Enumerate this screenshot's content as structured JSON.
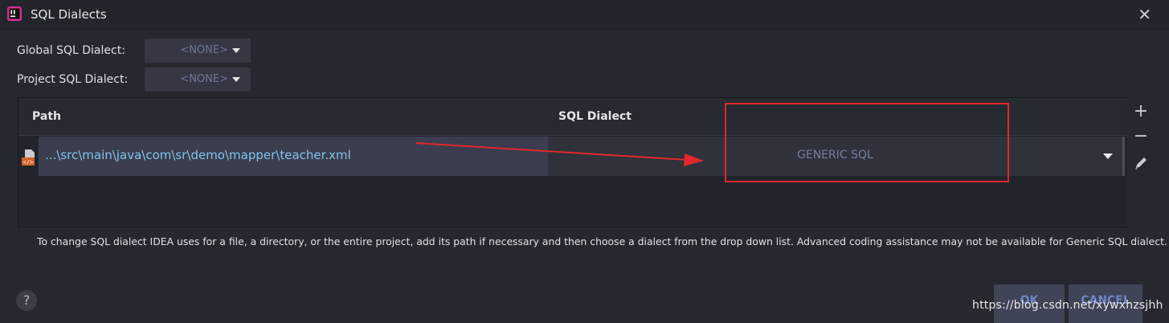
{
  "window": {
    "title": "SQL Dialects",
    "logo_icon": "intellij-idea-logo-icon",
    "close_icon": "close-icon",
    "close_glyph": "✕"
  },
  "global_dialect": {
    "label": "Global SQL Dialect:",
    "value": "<NONE>"
  },
  "project_dialect": {
    "label": "Project SQL Dialect:",
    "value": "<NONE>"
  },
  "table": {
    "columns": [
      "Path",
      "SQL Dialect"
    ],
    "rows": [
      {
        "path": "...\\src\\main\\java\\com\\sr\\demo\\mapper\\teacher.xml",
        "dialect": "GENERIC SQL",
        "icon": "xml-file-icon"
      }
    ]
  },
  "toolbar": {
    "add_glyph": "+",
    "remove_glyph": "−",
    "edit_icon": "pencil-icon"
  },
  "hint": "To change SQL dialect IDEA uses for a file, a directory, or the entire project, add its path if necessary and then choose a dialect from the drop down list. Advanced coding assistance may not be available for Generic SQL dialect.",
  "footer": {
    "help_glyph": "?",
    "ok_label": "OK",
    "cancel_label": "CANCEL"
  },
  "watermark": "https://blog.csdn.net/xywxhzsjhh",
  "colors": {
    "annotation": "#e0282b",
    "path_text": "#7fc4ee",
    "background": "#262830"
  }
}
